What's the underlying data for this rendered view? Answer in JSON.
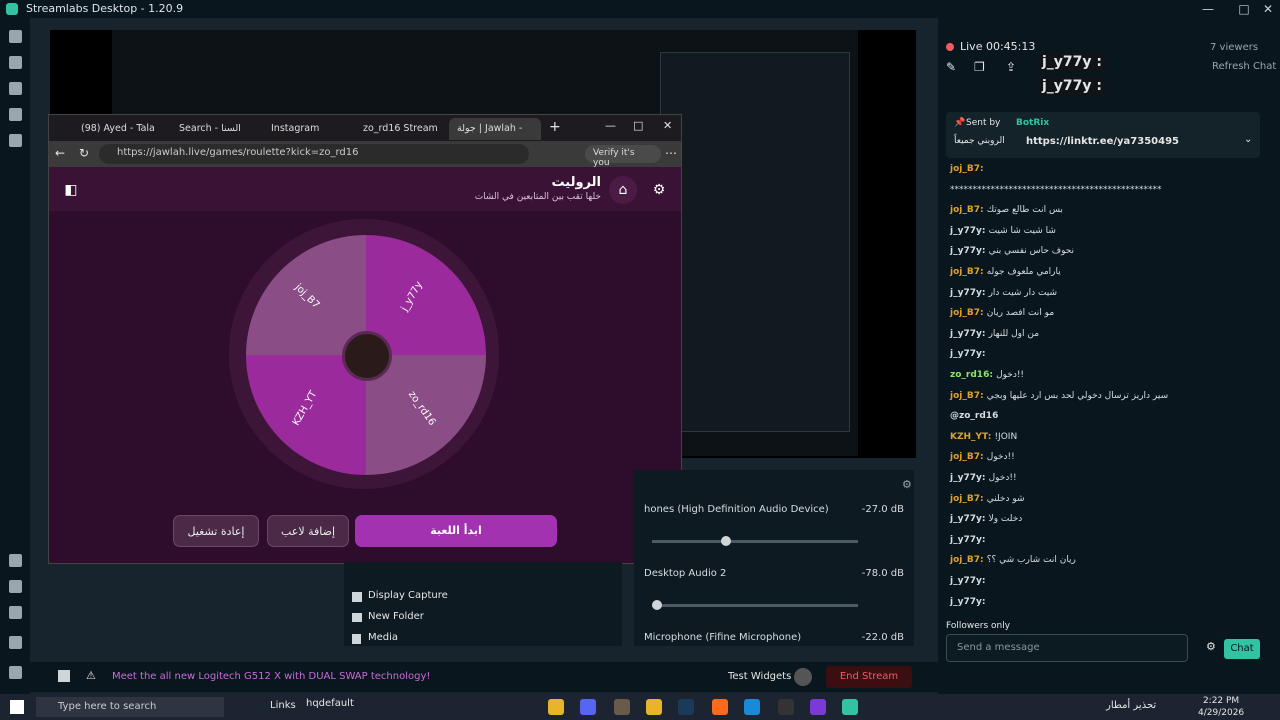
{
  "window": {
    "title": "Streamlabs Desktop - 1.20.9"
  },
  "browser": {
    "tabs": [
      {
        "label": "(98) Ayed - Tala"
      },
      {
        "label": "Search - السنا"
      },
      {
        "label": "Instagram"
      },
      {
        "label": "zo_rd16 Stream"
      },
      {
        "label": "جولة | Jawlah -"
      }
    ],
    "url": "https://jawlah.live/games/roulette?kick=zo_rd16",
    "verify_label": "Verify it's you",
    "page": {
      "title": "الروليت",
      "subtitle": "خلها تقب بين المتابعين في الشات",
      "wheel_names": [
        "joj_B7",
        "j_y77y",
        "KZH_YT",
        "zo_rd16"
      ],
      "start_button": "ابدأ اللعبة",
      "add_player_button": "إضافة لاعب",
      "replay_button": "إعادة تشغيل"
    }
  },
  "chat": {
    "live_label": "Live 00:45:13",
    "viewers": "7 viewers",
    "refresh": "Refresh Chat",
    "pinned": {
      "sent_by_label": "Sent by",
      "sent_by_user": "BotRix",
      "text": "الروبني جميعاً",
      "link": "https://linktr.ee/ya7350495"
    },
    "top_users": [
      "j_y77y :",
      "j_y77y :"
    ],
    "messages": [
      {
        "user": "joj_B7:",
        "color": "#e0a030",
        "text": ""
      },
      {
        "user": "",
        "color": "#d7dde0",
        "text": "***********************************************"
      },
      {
        "user": "joj_B7:",
        "color": "#e0a030",
        "text": "بس انت طالع صوتك"
      },
      {
        "user": "j_y77y:",
        "color": "#d7dde0",
        "text": "شا شيت شا شيت"
      },
      {
        "user": "j_y77y:",
        "color": "#d7dde0",
        "text": "نحوف حاس نفسي بني"
      },
      {
        "user": "joj_B7:",
        "color": "#e0a030",
        "text": "يارامي ملعوف جوله"
      },
      {
        "user": "j_y77y:",
        "color": "#d7dde0",
        "text": "شيت دار شيت دار"
      },
      {
        "user": "joj_B7:",
        "color": "#e0a030",
        "text": "مو انت افصد ريان"
      },
      {
        "user": "j_y77y:",
        "color": "#d7dde0",
        "text": "من اول للنهار"
      },
      {
        "user": "j_y77y:",
        "color": "#d7dde0",
        "text": ""
      },
      {
        "user": "zo_rd16:",
        "color": "#8fe36a",
        "text": "دخول!!"
      },
      {
        "user": "joj_B7:",
        "color": "#e0a030",
        "text": "سير داريز ترسال دخولي لحد بس ارد عليها وبجي"
      },
      {
        "user": "@zo_rd16",
        "color": "#d7dde0",
        "text": ""
      },
      {
        "user": "KZH_YT:",
        "color": "#e0a030",
        "text": "!JOIN"
      },
      {
        "user": "joj_B7:",
        "color": "#e0a030",
        "text": "دخول!!"
      },
      {
        "user": "j_y77y:",
        "color": "#d7dde0",
        "text": "دخول!!"
      },
      {
        "user": "joj_B7:",
        "color": "#e0a030",
        "text": "شو دخلني"
      },
      {
        "user": "j_y77y:",
        "color": "#d7dde0",
        "text": "دخلت ولا"
      },
      {
        "user": "j_y77y:",
        "color": "#d7dde0",
        "text": ""
      },
      {
        "user": "joj_B7:",
        "color": "#e0a030",
        "text": "ريان انت شارب شي ؟؟"
      },
      {
        "user": "j_y77y:",
        "color": "#d7dde0",
        "text": ""
      },
      {
        "user": "j_y77y:",
        "color": "#d7dde0",
        "text": ""
      }
    ],
    "followers_only": "Followers only",
    "input_placeholder": "Send a message",
    "send_button": "Chat"
  },
  "sources": [
    "Display Capture",
    "New Folder",
    "Media"
  ],
  "mixer": [
    {
      "name": "hones (High Definition Audio Device)",
      "db": "-27.0 dB",
      "level": 0.35
    },
    {
      "name": "Desktop Audio 2",
      "db": "-78.0 dB",
      "level": 0.0
    },
    {
      "name": "Microphone (Fifine Microphone)",
      "db": "-22.0 dB",
      "level": 0.0
    }
  ],
  "footer": {
    "promo": "Meet the all new Logitech G512 X with DUAL SWAP technology!",
    "test_widgets": "Test Widgets",
    "end_stream": "End Stream"
  },
  "taskbar": {
    "search_placeholder": "Type here to search",
    "links": "Links",
    "hqdefault": "hqdefault",
    "weather": "تحذير أمطار",
    "time": "2:22 PM",
    "date": "4/29/2026"
  },
  "colors": {
    "accent": "#31c3a2",
    "purple": "#9b2a9c",
    "purple_light": "#8a4d86"
  }
}
